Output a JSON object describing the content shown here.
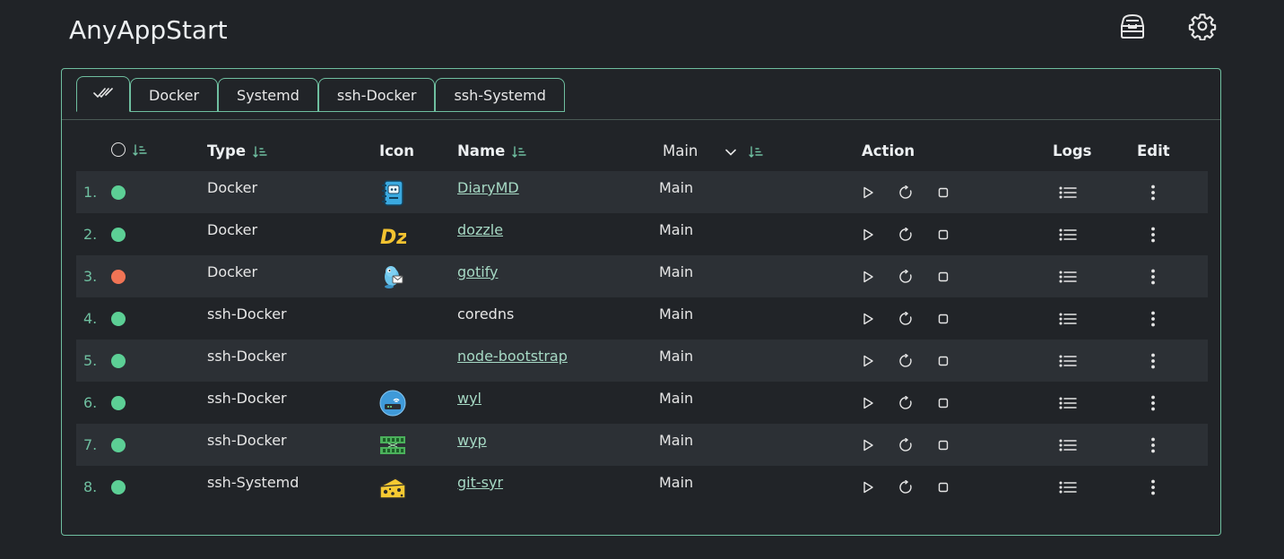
{
  "app": {
    "title": "AnyAppStart",
    "top_icons": [
      "toolbox-icon",
      "gear-icon"
    ]
  },
  "tabs": [
    {
      "label": "",
      "icon": "double-check-icon",
      "active": true
    },
    {
      "label": "Docker",
      "active": false
    },
    {
      "label": "Systemd",
      "active": false
    },
    {
      "label": "ssh-Docker",
      "active": false
    },
    {
      "label": "ssh-Systemd",
      "active": false
    }
  ],
  "table": {
    "headers": {
      "status": "",
      "type": "Type",
      "icon": "Icon",
      "name": "Name",
      "group_filter": "Main",
      "action": "Action",
      "logs": "Logs",
      "edit": "Edit"
    },
    "rows": [
      {
        "index": "1.",
        "status": "running",
        "status_color": "#5ccf95",
        "type": "Docker",
        "icon": "notebook-icon",
        "name": "DiaryMD",
        "linked": true,
        "group": "Main"
      },
      {
        "index": "2.",
        "status": "running",
        "status_color": "#5ccf95",
        "type": "Docker",
        "icon": "dozzle-logo-icon",
        "name": "dozzle",
        "linked": true,
        "group": "Main"
      },
      {
        "index": "3.",
        "status": "stopped",
        "status_color": "#f07455",
        "type": "Docker",
        "icon": "gotify-logo-icon",
        "name": "gotify",
        "linked": true,
        "group": "Main"
      },
      {
        "index": "4.",
        "status": "running",
        "status_color": "#5ccf95",
        "type": "ssh-Docker",
        "icon": "",
        "name": "coredns",
        "linked": false,
        "group": "Main"
      },
      {
        "index": "5.",
        "status": "running",
        "status_color": "#5ccf95",
        "type": "ssh-Docker",
        "icon": "",
        "name": "node-bootstrap",
        "linked": true,
        "group": "Main"
      },
      {
        "index": "6.",
        "status": "running",
        "status_color": "#5ccf95",
        "type": "ssh-Docker",
        "icon": "router-icon",
        "name": "wyl",
        "linked": true,
        "group": "Main"
      },
      {
        "index": "7.",
        "status": "running",
        "status_color": "#5ccf95",
        "type": "ssh-Docker",
        "icon": "network-switch-icon",
        "name": "wyp",
        "linked": true,
        "group": "Main"
      },
      {
        "index": "8.",
        "status": "running",
        "status_color": "#5ccf95",
        "type": "ssh-Systemd",
        "icon": "cheese-icon",
        "name": "git-syr",
        "linked": true,
        "group": "Main"
      }
    ]
  },
  "colors": {
    "background": "#202327",
    "accent": "#6fbfa0",
    "row_stripe": "#2c3035",
    "link": "#a6d9c4"
  }
}
